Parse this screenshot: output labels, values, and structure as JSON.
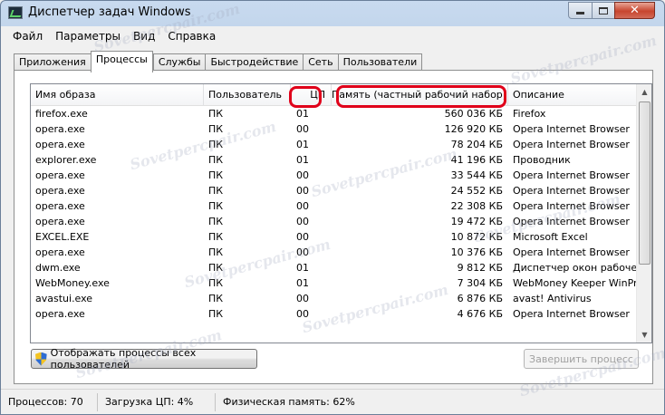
{
  "window": {
    "title": "Диспетчер задач Windows",
    "controls": {
      "minimize": "",
      "maximize": "",
      "close": "✕"
    }
  },
  "menu": [
    "Файл",
    "Параметры",
    "Вид",
    "Справка"
  ],
  "tabs": [
    "Приложения",
    "Процессы",
    "Службы",
    "Быстродействие",
    "Сеть",
    "Пользователи"
  ],
  "active_tab": "Процессы",
  "columns": {
    "name": "Имя образа",
    "user": "Пользователь",
    "cpu": "ЦП",
    "memory": "Память (частный рабочий набор)",
    "description": "Описание"
  },
  "processes": [
    {
      "name": "firefox.exe",
      "user": "ПК",
      "cpu": "01",
      "memory": "560 036 КБ",
      "description": "Firefox"
    },
    {
      "name": "opera.exe",
      "user": "ПК",
      "cpu": "00",
      "memory": "126 920 КБ",
      "description": "Opera Internet Browser"
    },
    {
      "name": "opera.exe",
      "user": "ПК",
      "cpu": "01",
      "memory": "78 204 КБ",
      "description": "Opera Internet Browser"
    },
    {
      "name": "explorer.exe",
      "user": "ПК",
      "cpu": "01",
      "memory": "41 196 КБ",
      "description": "Проводник"
    },
    {
      "name": "opera.exe",
      "user": "ПК",
      "cpu": "00",
      "memory": "33 544 КБ",
      "description": "Opera Internet Browser"
    },
    {
      "name": "opera.exe",
      "user": "ПК",
      "cpu": "00",
      "memory": "24 552 КБ",
      "description": "Opera Internet Browser"
    },
    {
      "name": "opera.exe",
      "user": "ПК",
      "cpu": "00",
      "memory": "22 308 КБ",
      "description": "Opera Internet Browser"
    },
    {
      "name": "opera.exe",
      "user": "ПК",
      "cpu": "00",
      "memory": "19 472 КБ",
      "description": "Opera Internet Browser"
    },
    {
      "name": "EXCEL.EXE",
      "user": "ПК",
      "cpu": "00",
      "memory": "10 872 КБ",
      "description": "Microsoft Excel"
    },
    {
      "name": "opera.exe",
      "user": "ПК",
      "cpu": "00",
      "memory": "10 376 КБ",
      "description": "Opera Internet Browser"
    },
    {
      "name": "dwm.exe",
      "user": "ПК",
      "cpu": "01",
      "memory": "9 812 КБ",
      "description": "Диспетчер окон рабочего"
    },
    {
      "name": "WebMoney.exe",
      "user": "ПК",
      "cpu": "01",
      "memory": "7 304 КБ",
      "description": "WebMoney Keeper WinPro"
    },
    {
      "name": "avastui.exe",
      "user": "ПК",
      "cpu": "00",
      "memory": "6 876 КБ",
      "description": "avast! Antivirus"
    },
    {
      "name": "opera.exe",
      "user": "ПК",
      "cpu": "00",
      "memory": "4 676 КБ",
      "description": "Opera Internet Browser"
    }
  ],
  "buttons": {
    "show_all": "Отображать процессы всех пользователей",
    "end_process": "Завершить процесс"
  },
  "status": {
    "processes": "Процессов: 70",
    "cpu": "Загрузка ЦП: 4%",
    "memory": "Физическая память: 62%"
  },
  "watermark": "Sovetpercpair.com",
  "colors": {
    "highlight": "#e0001a",
    "titlebar": "#c3d6ec",
    "close": "#c7452e"
  }
}
